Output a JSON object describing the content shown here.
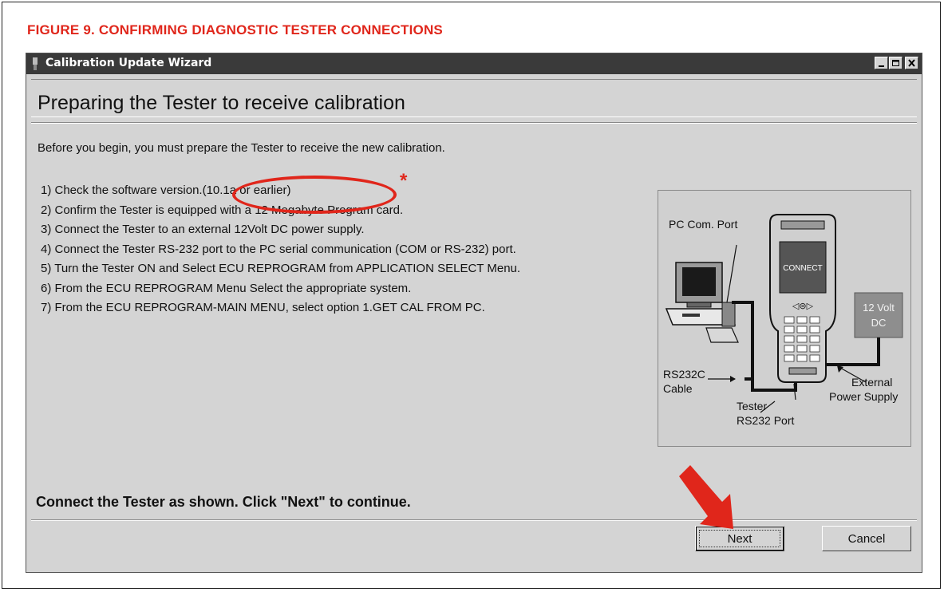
{
  "figure": {
    "title": "FIGURE 9.  CONFIRMING DIAGNOSTIC TESTER CONNECTIONS"
  },
  "window": {
    "title": "Calibration Update Wizard",
    "controls": [
      "minimize",
      "maximize",
      "close"
    ]
  },
  "page": {
    "heading": "Preparing the Tester to receive calibration",
    "intro": "Before you begin, you must prepare the Tester to receive the new calibration.",
    "steps": [
      "1) Check the software version.(10.1a or earlier)",
      "2) Confirm the Tester is equipped with a 12 Megabyte Program card.",
      "3) Connect the Tester to an external 12Volt DC power supply.",
      "4) Connect the Tester RS-232 port to the PC serial communication (COM or RS-232) port.",
      "5) Turn the Tester ON and Select ECU REPROGRAM from APPLICATION SELECT Menu.",
      "6) From the ECU REPROGRAM Menu Select the appropriate system.",
      "7) From the ECU REPROGRAM-MAIN MENU, select option 1.GET CAL FROM PC."
    ],
    "annotation_mark": "*",
    "instruction": "Connect the Tester as shown. Click \"Next\" to continue."
  },
  "diagram": {
    "pc_com_port": "PC Com. Port",
    "connect_screen": "CONNECT",
    "power_line1": "12 Volt",
    "power_line2": "DC",
    "rs232c_line1": "RS232C",
    "rs232c_line2": "Cable",
    "tester_line1": "Tester",
    "tester_line2": "RS232 Port",
    "external_line1": "External",
    "external_line2": "Power Supply"
  },
  "buttons": {
    "next": "Next",
    "cancel": "Cancel"
  },
  "colors": {
    "annotation_red": "#e0261b",
    "titlebar": "#3a3a3a",
    "window_bg": "#d4d4d4"
  }
}
